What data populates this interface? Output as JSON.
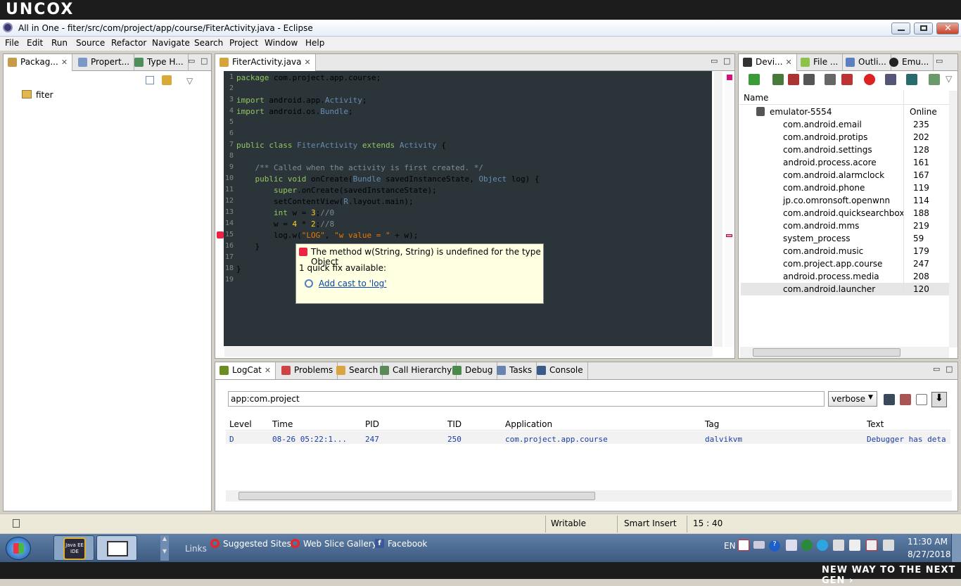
{
  "brand": "UNCOX",
  "window": {
    "title": "All in One - fiter/src/com/project/app/course/FiterActivity.java - Eclipse"
  },
  "menu": [
    "File",
    "Edit",
    "Run",
    "Source",
    "Refactor",
    "Navigate",
    "Search",
    "Project",
    "Window",
    "Help"
  ],
  "left_tabs": [
    "Packag...",
    "Propert...",
    "Type H..."
  ],
  "tree": {
    "project": "fiter"
  },
  "editor": {
    "tab": "FiterActivity.java",
    "line_numbers": [
      "1",
      "2",
      "3",
      "4",
      "5",
      "6",
      "7",
      "8",
      "9",
      "10",
      "11",
      "12",
      "13",
      "14",
      "15",
      "16",
      "17",
      "18",
      "19"
    ],
    "lines": [
      "package com.project.app.course;",
      "",
      "import android.app.Activity;",
      "import android.os.Bundle;",
      "",
      "",
      "public class FiterActivity extends Activity {",
      "",
      "    /** Called when the activity is first created. */",
      "    public void onCreate(Bundle savedInstanceState, Object log) {",
      "        super.onCreate(savedInstanceState);",
      "        setContentView(R.layout.main);",
      "        int w = 3;//0",
      "        w = 4 * 2;//8",
      "        log.w(\"LOG\", \"w value = \" + w);",
      "    }",
      "",
      "}",
      ""
    ],
    "tooltip": {
      "error": "The method w(String, String) is undefined for the type Object",
      "quickfix_label": "1 quick fix available:",
      "fix": "Add cast to 'log'"
    }
  },
  "right_tabs": [
    "Devi...",
    "File ...",
    "Outli...",
    "Emu..."
  ],
  "devices": {
    "col_name": "Name",
    "emulator": "emulator-5554",
    "status": "Online",
    "processes": [
      {
        "name": "com.android.email",
        "pid": "235"
      },
      {
        "name": "com.android.protips",
        "pid": "202"
      },
      {
        "name": "com.android.settings",
        "pid": "128"
      },
      {
        "name": "android.process.acore",
        "pid": "161"
      },
      {
        "name": "com.android.alarmclock",
        "pid": "167"
      },
      {
        "name": "com.android.phone",
        "pid": "119"
      },
      {
        "name": "jp.co.omronsoft.openwnn",
        "pid": "114"
      },
      {
        "name": "com.android.quicksearchbox",
        "pid": "188"
      },
      {
        "name": "com.android.mms",
        "pid": "219"
      },
      {
        "name": "system_process",
        "pid": "59"
      },
      {
        "name": "com.android.music",
        "pid": "179"
      },
      {
        "name": "com.project.app.course",
        "pid": "247"
      },
      {
        "name": "android.process.media",
        "pid": "208"
      },
      {
        "name": "com.android.launcher",
        "pid": "120"
      }
    ]
  },
  "bottom_tabs": [
    "LogCat",
    "Problems",
    "Search",
    "Call Hierarchy",
    "Debug",
    "Tasks",
    "Console"
  ],
  "logcat": {
    "filter_value": "app:com.project",
    "level_select": "verbose",
    "headers": [
      "Level",
      "Time",
      "PID",
      "TID",
      "Application",
      "Tag",
      "Text"
    ],
    "row": {
      "level": "D",
      "time": "08-26 05:22:1...",
      "pid": "247",
      "tid": "250",
      "app": "com.project.app.course",
      "tag": "dalvikvm",
      "text": "Debugger has deta"
    }
  },
  "status": {
    "writable": "Writable",
    "insert": "Smart Insert",
    "position": "15 : 40"
  },
  "taskbar": {
    "links_label": "Links",
    "links": [
      "Suggested Sites",
      "Web Slice Gallery",
      "Facebook"
    ],
    "lang": "EN",
    "time": "11:30 AM",
    "date": "8/27/2018",
    "app_badge": "Java EE IDE"
  },
  "slogan": "NEW WAY TO THE NEXT GEN ›",
  "colors": {
    "editor_bg": "#2b3439",
    "keyword": "#93c763",
    "type": "#678cb1",
    "comment": "#7d8c93",
    "string": "#ec7600",
    "number": "#ffcd22",
    "link": "#0645ad",
    "log_text": "#1a3da0"
  }
}
